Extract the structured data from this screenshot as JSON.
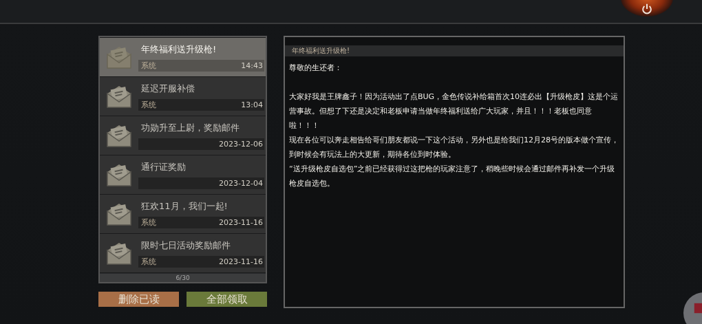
{
  "mails": [
    {
      "title": "年终福利送升级枪!",
      "sender": "系统",
      "time": "14:43",
      "selected": true
    },
    {
      "title": "延迟开服补偿",
      "sender": "系统",
      "time": "13:04",
      "selected": false
    },
    {
      "title": "功勋升至上尉，奖励邮件",
      "time": "2023-12-06",
      "selected": false
    },
    {
      "title": "通行证奖励",
      "time": "2023-12-04",
      "selected": false
    },
    {
      "title": "狂欢11月，我们一起!",
      "sender": "系统",
      "time": "2023-11-16",
      "selected": false
    },
    {
      "title": "限时七日活动奖励邮件",
      "sender": "系统",
      "time": "2023-11-16",
      "selected": false
    }
  ],
  "mail_count": "6/30",
  "buttons": [
    {
      "label": "删除已读",
      "kind": "delete"
    },
    {
      "label": "全部领取",
      "kind": "claim"
    }
  ],
  "message": {
    "title": "年终福利送升级枪!",
    "greeting": "尊敬的生还者：",
    "paragraphs": [
      "大家好我是王牌鑫子！因为活动出了点BUG，金色传说补给箱首次10连必出【升级枪皮】这是个运营事故。但想了下还是决定和老板申请当做年终福利送给广大玩家，并且！！！老板也同意啦！！！",
      "现在各位可以奔走相告给哥们朋友都说一下这个活动，另外也是给我们12月28号的版本做个宣传，到时候会有玩法上的大更新，期待各位到时体验。",
      "“送升级枪皮自选包”之前已经获得过这把枪的玩家注意了，稍晚些时候会通过邮件再补发一个升级枪皮自选包。"
    ]
  }
}
